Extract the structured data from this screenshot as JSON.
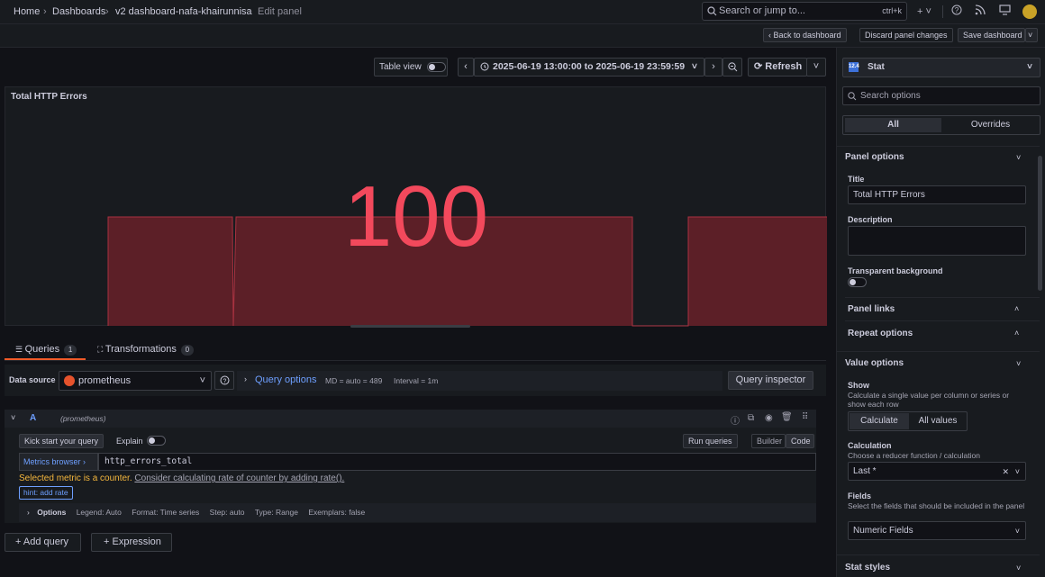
{
  "breadcrumbs": {
    "home": "Home",
    "dashboards": "Dashboards",
    "dashboard": "v2 dashboard-nafa-khairunnisa",
    "current": "Edit panel"
  },
  "search": {
    "placeholder": "Search or jump to...",
    "shortcut": "ctrl+k"
  },
  "subbar": {
    "back": "Back to dashboard",
    "discard": "Discard panel changes",
    "save": "Save dashboard"
  },
  "toolbar": {
    "table_view": "Table view",
    "time_range": "2025-06-19 13:00:00 to 2025-06-19 23:59:59",
    "refresh": "Refresh"
  },
  "panel": {
    "title": "Total HTTP Errors",
    "value": "100",
    "value_color": "#f2495c"
  },
  "tabs": {
    "queries": "Queries",
    "queries_count": "1",
    "transformations": "Transformations",
    "transformations_count": "0"
  },
  "query_row": {
    "data_source_label": "Data source",
    "data_source": "prometheus",
    "query_options": "Query options",
    "md": "MD = auto = 489",
    "interval": "Interval = 1m",
    "inspector": "Query inspector"
  },
  "query": {
    "ref": "A",
    "source": "(prometheus)",
    "kickstart": "Kick start your query",
    "explain": "Explain",
    "run": "Run queries",
    "builder": "Builder",
    "code": "Code",
    "metrics_browser": "Metrics browser",
    "expr": "http_errors_total",
    "warning": "Selected metric is a counter.",
    "warning_link": "Consider calculating rate of counter by adding rate().",
    "hint": "hint: add rate",
    "options": "Options",
    "legend": "Legend: Auto",
    "format": "Format: Time series",
    "step": "Step: auto",
    "type": "Type: Range",
    "exemplars": "Exemplars: false"
  },
  "actions": {
    "add_query": "Add query",
    "expression": "Expression"
  },
  "options_pane": {
    "viz": "Stat",
    "search_placeholder": "Search options",
    "tab_all": "All",
    "tab_overrides": "Overrides",
    "panel_options": "Panel options",
    "title_label": "Title",
    "title_value": "Total HTTP Errors",
    "description_label": "Description",
    "transparent_label": "Transparent background",
    "panel_links": "Panel links",
    "repeat_options": "Repeat options",
    "value_options": "Value options",
    "show_label": "Show",
    "show_desc": "Calculate a single value per column or series or show each row",
    "show_calculate": "Calculate",
    "show_all": "All values",
    "calc_label": "Calculation",
    "calc_desc": "Choose a reducer function / calculation",
    "calc_value": "Last *",
    "fields_label": "Fields",
    "fields_desc": "Select the fields that should be included in the panel",
    "fields_value": "Numeric Fields",
    "stat_styles": "Stat styles"
  },
  "chart_data": {
    "type": "area",
    "series": [
      {
        "values": [
          0,
          100,
          100,
          0,
          100,
          100,
          100,
          0,
          0,
          100,
          100
        ]
      }
    ]
  }
}
